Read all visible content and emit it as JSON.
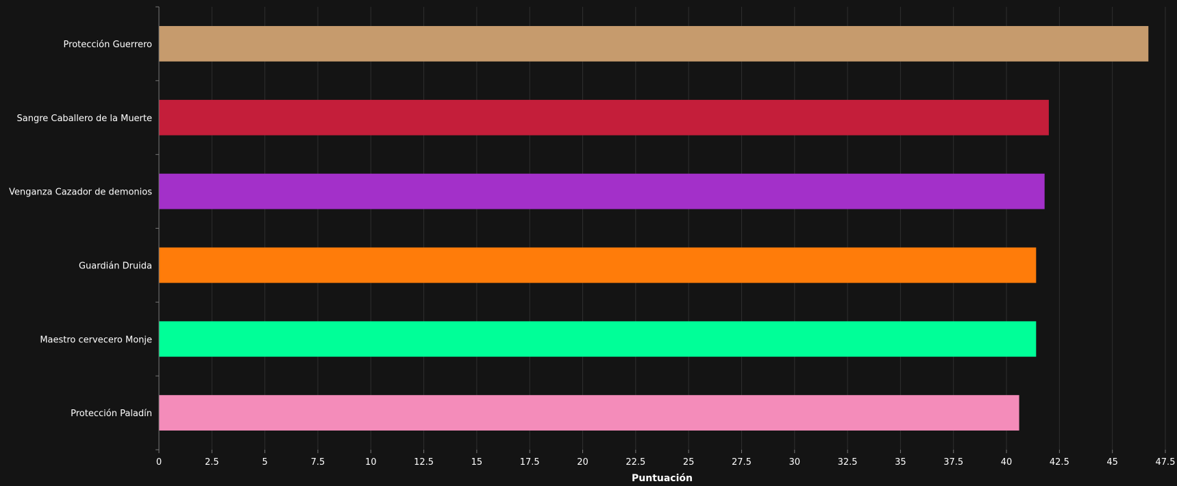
{
  "chart_data": {
    "type": "bar",
    "orientation": "horizontal",
    "categories": [
      "Protección Guerrero",
      "Sangre Caballero de la Muerte",
      "Venganza Cazador de demonios",
      "Guardián Druida",
      "Maestro cervecero Monje",
      "Protección Paladín"
    ],
    "values": [
      46.7,
      42.0,
      41.8,
      41.4,
      41.4,
      40.6
    ],
    "colors": [
      "#C69B6D",
      "#C41E3A",
      "#A330C9",
      "#FF7C0A",
      "#00FF98",
      "#F48CBA"
    ],
    "xlabel": "Puntuación",
    "ylabel": "",
    "title": "",
    "xlim": [
      0,
      47.5
    ],
    "xticks": [
      0,
      2.5,
      5,
      7.5,
      10,
      12.5,
      15,
      17.5,
      20,
      22.5,
      25,
      27.5,
      30,
      32.5,
      35,
      37.5,
      40,
      42.5,
      45,
      47.5
    ],
    "xtick_labels": [
      "0",
      "2.5",
      "5",
      "7.5",
      "10",
      "12.5",
      "15",
      "17.5",
      "20",
      "22.5",
      "25",
      "27.5",
      "30",
      "32.5",
      "35",
      "37.5",
      "40",
      "42.5",
      "45",
      "47.5"
    ],
    "grid": true,
    "background": "#141414"
  }
}
